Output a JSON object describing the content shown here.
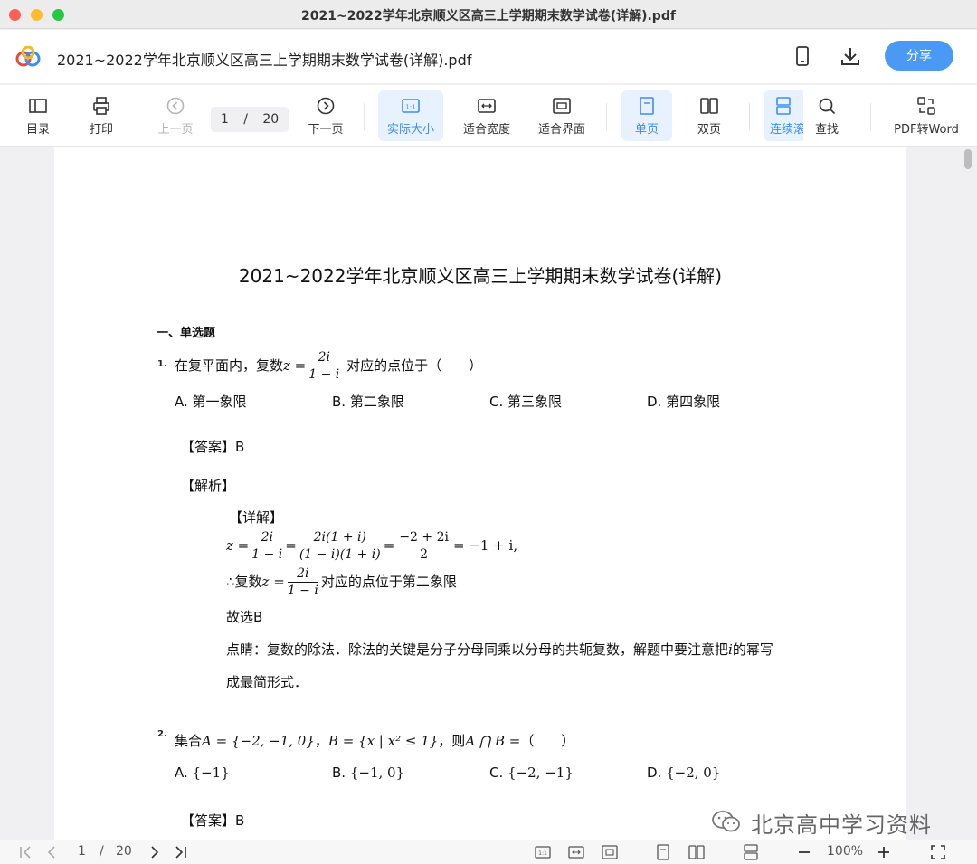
{
  "window": {
    "title": "2021~2022学年北京顺义区高三上学期期末数学试卷(详解).pdf"
  },
  "header": {
    "doc_title": "2021~2022学年北京顺义区高三上学期期末数学试卷(详解).pdf",
    "share_label": "分享",
    "icons": [
      "logo-icon",
      "phone-icon",
      "download-icon"
    ]
  },
  "toolbar": {
    "toc": "目录",
    "print": "打印",
    "prev": "上一页",
    "page_current": "1",
    "page_sep": "/",
    "page_total": "20",
    "next": "下一页",
    "actual_size": "实际大小",
    "fit_width": "适合宽度",
    "fit_page": "适合界面",
    "single": "单页",
    "double": "双页",
    "continuous": "连续滚",
    "find": "查找",
    "pdf2word": "PDF转Word"
  },
  "document": {
    "title": "2021~2022学年北京顺义区高三上学期期末数学试卷(详解)",
    "section": "一、单选题",
    "q1": {
      "num": "1.",
      "stem_pre": "在复平面内，复数",
      "stem_z": "z =",
      "frac_num": "2i",
      "frac_den": "1 − i",
      "stem_post": "对应的点位于（　　）",
      "options": [
        "A. 第一象限",
        "B. 第二象限",
        "C. 第三象限",
        "D. 第四象限"
      ],
      "answer": "【答案】B",
      "analysis": "【解析】",
      "detail": "【详解】",
      "eq_z": "z =",
      "eq_f1n": "2i",
      "eq_f1d": "1 − i",
      "eq_eq1": "=",
      "eq_f2n": "2i(1 + i)",
      "eq_f2d": "(1 − i)(1 + i)",
      "eq_eq2": "=",
      "eq_f3n": "−2 + 2i",
      "eq_f3d": "2",
      "eq_tail": "= −1 + i,",
      "l2_pre": "∴复数",
      "l2_z": "z =",
      "l2_fn": "2i",
      "l2_fd": "1 − i",
      "l2_post": "对应的点位于第二象限",
      "l3": "故选B",
      "l4_a": "点睛：复数的除法．除法的关键是分子分母同乘以分母的共轭复数，解题中要注意把",
      "l4_i": "i",
      "l4_b": "的幂写",
      "l5": "成最简形式．"
    },
    "q2": {
      "num": "2.",
      "stem_a": "集合",
      "stem_set_a": "A = {−2, −1, 0}",
      "stem_comma": "，",
      "stem_set_b": "B = {x | x² ≤ 1}",
      "stem_then": "，则",
      "stem_expr": "A ⋂ B =",
      "stem_paren": "（　　）",
      "options_label": [
        "A.",
        "B.",
        "C.",
        "D."
      ],
      "options_math": [
        "{−1}",
        "{−1, 0}",
        "{−2, −1}",
        "{−2, 0}"
      ],
      "answer": "【答案】B"
    }
  },
  "bottombar": {
    "page_current": "1",
    "page_sep": "/",
    "page_total": "20",
    "zoom": "100%"
  },
  "watermark": "北京高中学习资料"
}
